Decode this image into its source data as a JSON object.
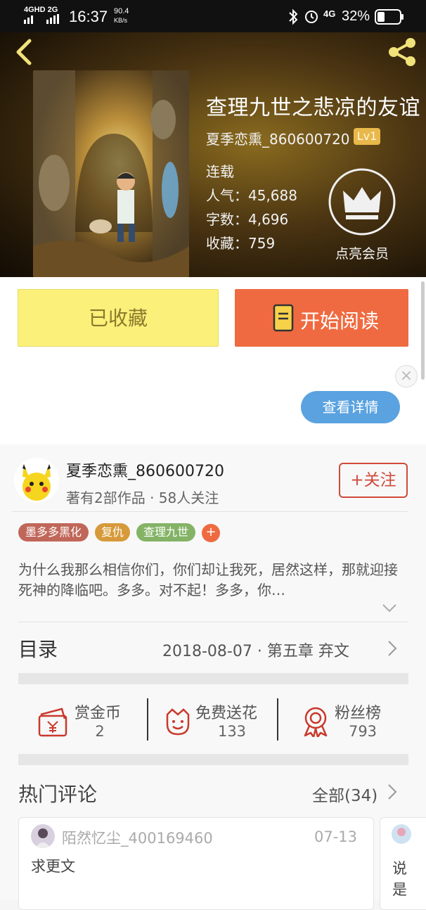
{
  "status_bar": {
    "network": "4GHD 2G",
    "time": "16:37",
    "speed_value": "90.4",
    "speed_unit": "KB/s",
    "signal_right": "4G",
    "battery": "32%"
  },
  "book": {
    "title": "查理九世之悲凉的友谊",
    "author": "夏季恋熏_860600720",
    "level": "Lv1",
    "status": "连载",
    "popularity_label": "人气：",
    "popularity": "45,688",
    "words_label": "字数：",
    "words": "4,696",
    "favorites_label": "收藏：",
    "favorites": "759"
  },
  "vip": {
    "label": "点亮会员"
  },
  "actions": {
    "collect_label": "已收藏",
    "read_label": "开始阅读"
  },
  "ad": {
    "close": "×",
    "detail_label": "查看详情"
  },
  "author_card": {
    "name": "夏季恋熏_860600720",
    "stats": "著有2部作品 · 58人关注",
    "follow_label": "+关注"
  },
  "tags": [
    {
      "label": "墨多多黑化",
      "color": "#c0675a"
    },
    {
      "label": "复仇",
      "color": "#d79a3a"
    },
    {
      "label": "查理九世",
      "color": "#84b366"
    }
  ],
  "tag_add": "+",
  "description": "为什么我那么相信你们，你们却让我死，居然这样，那就迎接死神的降临吧。多多。对不起！多多，你…",
  "toc": {
    "label": "目录",
    "latest": "2018-08-07 · 第五章  弃文"
  },
  "stats": [
    {
      "label": "赏金币",
      "value": "2",
      "icon": "red-envelope-icon"
    },
    {
      "label": "免费送花",
      "value": "133",
      "icon": "flower-icon"
    },
    {
      "label": "粉丝榜",
      "value": "793",
      "icon": "medal-icon"
    }
  ],
  "hot_comments": {
    "title": "热门评论",
    "all_label": "全部(34)",
    "items": [
      {
        "user": "陌然忆尘_400169460",
        "date": "07-13",
        "text": "求更文"
      },
      {
        "text": "说是"
      }
    ]
  },
  "colors": {
    "accent_orange": "#ef6a40",
    "collect_yellow": "#fbf079",
    "follow_red": "#d04a3a",
    "detail_blue": "#5aa2e0"
  }
}
